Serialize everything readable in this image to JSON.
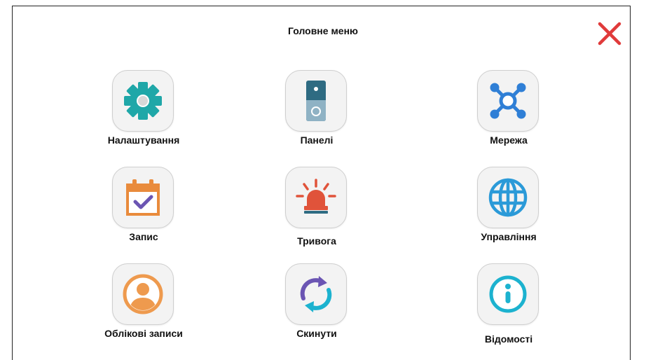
{
  "header": {
    "title": "Головне меню",
    "close_icon": "close-icon",
    "close_color": "#e03a3a"
  },
  "menu": {
    "items": [
      {
        "label": "Налаштування",
        "icon": "gear-icon",
        "color": "#1fa7a8"
      },
      {
        "label": "Панелі",
        "icon": "door-panel-icon",
        "color": "#2e6b82"
      },
      {
        "label": "Мережа",
        "icon": "network-icon",
        "color": "#2f7fd6"
      },
      {
        "label": "Запис",
        "icon": "calendar-check-icon",
        "color": "#e98b3c"
      },
      {
        "label": "Тривога",
        "icon": "alarm-siren-icon",
        "color": "#e0533a"
      },
      {
        "label": "Управління",
        "icon": "globe-icon",
        "color": "#2b9ad8"
      },
      {
        "label": "Облікові записи",
        "icon": "user-account-icon",
        "color": "#ee9a4e"
      },
      {
        "label": "Скинути",
        "icon": "reset-arrows-icon",
        "color": "#6b55b3"
      },
      {
        "label": "Відомості",
        "icon": "info-icon",
        "color": "#1cb2cf"
      }
    ]
  }
}
